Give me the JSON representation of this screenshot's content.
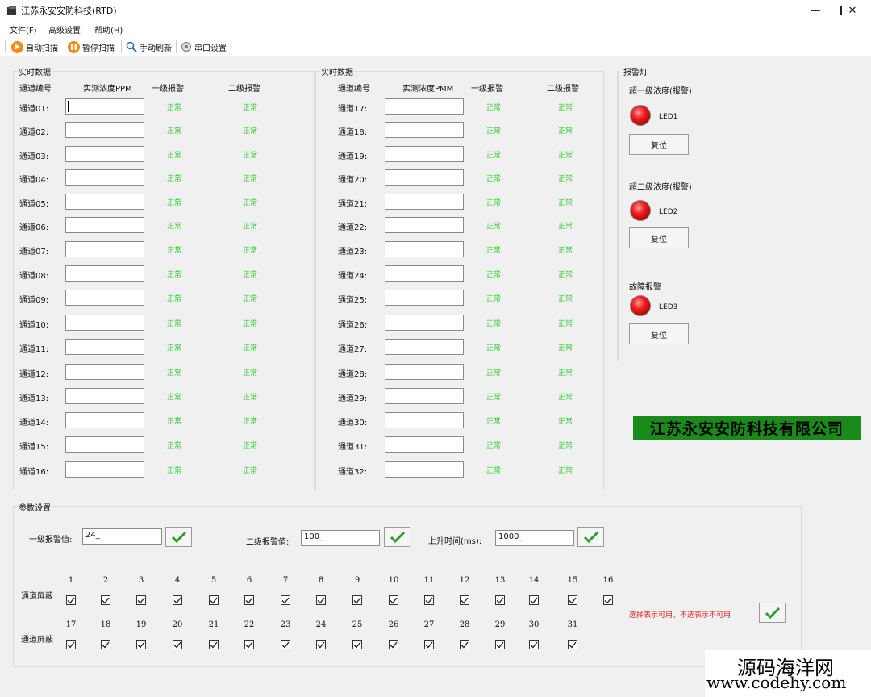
{
  "window": {
    "title": "江苏永安安防科技(RTD)"
  },
  "menu": [
    "文件(F)",
    "高级设置",
    "帮助(H)"
  ],
  "toolbar": {
    "auto_scan": "自动扫描",
    "pause_scan": "暂停扫描",
    "manual_refresh": "手动刷新",
    "serial_settings": "串口设置"
  },
  "realtime_left": {
    "title": "实时数据",
    "headers": {
      "channel": "通道编号",
      "measured": "实测浓度PPM",
      "level1": "一级报警",
      "level2": "二级报警"
    },
    "rows": [
      {
        "label": "通道01:",
        "l1": "正常",
        "l2": "正常"
      },
      {
        "label": "通道02:",
        "l1": "正常",
        "l2": "正常"
      },
      {
        "label": "通道03:",
        "l1": "正常",
        "l2": "正常"
      },
      {
        "label": "通道04:",
        "l1": "正常",
        "l2": "正常"
      },
      {
        "label": "通道05:",
        "l1": "正常",
        "l2": "正常"
      },
      {
        "label": "通道06:",
        "l1": "正常",
        "l2": "正常"
      },
      {
        "label": "通道07:",
        "l1": "正常",
        "l2": "正常"
      },
      {
        "label": "通道08:",
        "l1": "正常",
        "l2": "正常"
      },
      {
        "label": "通道09:",
        "l1": "正常",
        "l2": "正常"
      },
      {
        "label": "通道10:",
        "l1": "正常",
        "l2": "正常"
      },
      {
        "label": "通道11:",
        "l1": "正常",
        "l2": "正常"
      },
      {
        "label": "通道12:",
        "l1": "正常",
        "l2": "正常"
      },
      {
        "label": "通道13:",
        "l1": "正常",
        "l2": "正常"
      },
      {
        "label": "通道14:",
        "l1": "正常",
        "l2": "正常"
      },
      {
        "label": "通道15:",
        "l1": "正常",
        "l2": "正常"
      },
      {
        "label": "通道16:",
        "l1": "正常",
        "l2": "正常"
      }
    ]
  },
  "realtime_right": {
    "title": "实时数据",
    "headers": {
      "channel": "通道编号",
      "measured": "实测浓度PMM",
      "level1": "一级报警",
      "level2": "二级报警"
    },
    "rows": [
      {
        "label": "通道17:",
        "l1": "正常",
        "l2": "正常"
      },
      {
        "label": "通道18:",
        "l1": "正常",
        "l2": "正常"
      },
      {
        "label": "通道19:",
        "l1": "正常",
        "l2": "正常"
      },
      {
        "label": "通道20:",
        "l1": "正常",
        "l2": "正常"
      },
      {
        "label": "通道21:",
        "l1": "正常",
        "l2": "正常"
      },
      {
        "label": "通道22:",
        "l1": "正常",
        "l2": "正常"
      },
      {
        "label": "通道23:",
        "l1": "正常",
        "l2": "正常"
      },
      {
        "label": "通道24:",
        "l1": "正常",
        "l2": "正常"
      },
      {
        "label": "通道25:",
        "l1": "正常",
        "l2": "正常"
      },
      {
        "label": "通道26:",
        "l1": "正常",
        "l2": "正常"
      },
      {
        "label": "通道27:",
        "l1": "正常",
        "l2": "正常"
      },
      {
        "label": "通道28:",
        "l1": "正常",
        "l2": "正常"
      },
      {
        "label": "通道29:",
        "l1": "正常",
        "l2": "正常"
      },
      {
        "label": "通道30:",
        "l1": "正常",
        "l2": "正常"
      },
      {
        "label": "通道31:",
        "l1": "正常",
        "l2": "正常"
      },
      {
        "label": "通道32:",
        "l1": "正常",
        "l2": "正常"
      }
    ]
  },
  "alarm_panel": {
    "title": "报警灯",
    "items": [
      {
        "label": "超一级浓度(报警)",
        "led": "LED1",
        "reset": "复位"
      },
      {
        "label": "超二级浓度(报警)",
        "led": "LED2",
        "reset": "复位"
      },
      {
        "label": "故障报警",
        "led": "LED3",
        "reset": "复位"
      }
    ]
  },
  "company": "江苏永安安防科技有限公司",
  "params": {
    "title": "参数设置",
    "level1": {
      "label": "一级报警值:",
      "value": "24_"
    },
    "level2": {
      "label": "二级报警值:",
      "value": "100_"
    },
    "rise_time": {
      "label": "上升时间(ms):",
      "value": "1000_"
    },
    "mask_label": "通道屏蔽",
    "row1": [
      "1",
      "2",
      "3",
      "4",
      "5",
      "6",
      "7",
      "8",
      "9",
      "10",
      "11",
      "12",
      "13",
      "14",
      "15",
      "16"
    ],
    "row2": [
      "17",
      "18",
      "19",
      "20",
      "21",
      "22",
      "23",
      "24",
      "25",
      "26",
      "27",
      "28",
      "29",
      "30",
      "31"
    ],
    "hint": "选择表示可用，不选表示不可用"
  },
  "watermark": {
    "line1": "源码海洋网",
    "line2": "www.codehy.com"
  },
  "colors": {
    "status_ok": "#33cc33",
    "led_red": "#ee2222",
    "banner_green": "#1a8a1a",
    "hint_red": "#e02020",
    "toolbar_orange": "#f28b18"
  }
}
